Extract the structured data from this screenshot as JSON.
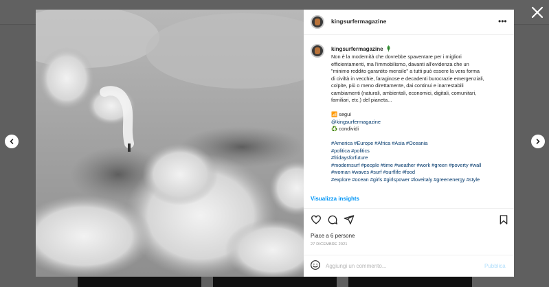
{
  "colors": {
    "link": "#00376b",
    "accent": "#0095f6",
    "publish_disabled": "#b2dffc",
    "text": "#262626",
    "muted": "#8e8e8e"
  },
  "icons": {
    "close": "close-icon",
    "prev": "chevron-left-icon",
    "next": "chevron-right-icon",
    "more": "more-horizontal-icon",
    "like": "heart-icon",
    "comment": "comment-icon",
    "share": "send-icon",
    "save": "bookmark-icon",
    "emoji": "emoji-icon",
    "leaf": "leaf-icon"
  },
  "post": {
    "username": "kingsurfermagazine",
    "carousel": {
      "count": 3,
      "active": 1
    },
    "caption": {
      "username": "kingsurfermagazine",
      "text_lines": [
        "Non è la modernità che dovrebbe spaventare per i migliori",
        "efficientamenti, ma l'immobilismo, davanti all'evidenza che un",
        "\"minimo reddito garantito mensile\" a tutti può essere la vera forma",
        "di civiltà in vecchie, faraginose e decadenti burocrazie emergenziali,",
        "colpite, più o meno direttamente, dai continui e inarrestabili",
        "cambiamenti (naturali, ambientali, economici, digitali, comunitari,",
        "familiari, etc.) del pianeta..."
      ],
      "follow_line": "📶 segui",
      "mention": "@kingsurfermagazine",
      "share_line": "♻️ condividi",
      "hashtag_lines": [
        "#America #Europe #Africa #Asia #Oceania",
        "#politica #politics",
        "#fridaysforfuture",
        "#modernsurf #people #time #weather #work #green #poverty #wall",
        "#woman #waves #surf #surflife #food",
        "#explore #ocean #girls #girlspower #loveitaly #greenenergy #style"
      ]
    },
    "insights_label": "Visualizza insights",
    "likes_text": "Piace a 6 persone",
    "date": "27 DICEMBRE 2021",
    "comment_placeholder": "Aggiungi un commento...",
    "publish_label": "Pubblica"
  }
}
